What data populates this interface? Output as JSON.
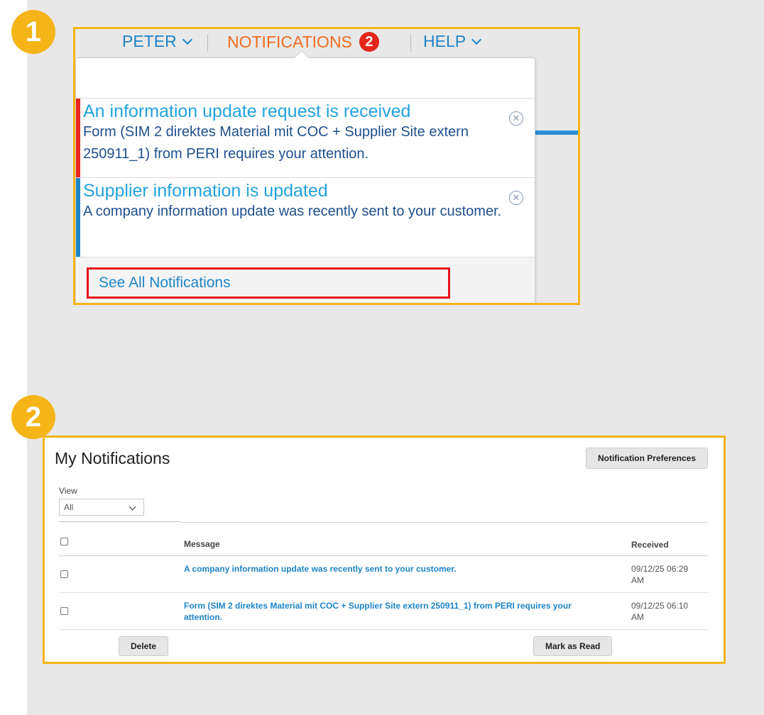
{
  "steps": [
    "1",
    "2"
  ],
  "nav": {
    "user_label": "PETER",
    "notifications_label": "NOTIFICATIONS",
    "notifications_count": "2",
    "help_label": "HELP"
  },
  "dropdown": {
    "items": [
      {
        "title": "An information update request is received",
        "body": "Form (SIM 2 direktes Material mit COC + Supplier Site extern 250911_1) from PERI requires your attention.",
        "stripe_color": "#e5261c"
      },
      {
        "title": "Supplier information is updated",
        "body": "A company information update was recently sent to your customer.",
        "stripe_color": "#1e85c8"
      }
    ],
    "see_all_label": "See All Notifications"
  },
  "my_notifications": {
    "title": "My Notifications",
    "preferences_button": "Notification Preferences",
    "view_label": "View",
    "view_selected": "All",
    "columns": {
      "message": "Message",
      "received": "Received"
    },
    "rows": [
      {
        "message": "A company information update was recently sent to your customer.",
        "received": "09/12/25 06:29 AM"
      },
      {
        "message": "Form (SIM 2 direktes Material mit COC + Supplier Site extern 250911_1) from PERI requires your attention.",
        "received": "09/12/25 06:10 AM"
      }
    ],
    "delete_button": "Delete",
    "mark_read_button": "Mark as Read"
  },
  "colors": {
    "step_badge": "#f5b418",
    "panel_border": "#f5b418",
    "highlight_border": "#e5121d",
    "link_blue": "#1e85c8",
    "notifications_orange": "#f06c1f",
    "badge_red": "#e5261c"
  },
  "icons": [
    "chevron-down-icon",
    "close-circle-icon",
    "checkbox-icon"
  ]
}
